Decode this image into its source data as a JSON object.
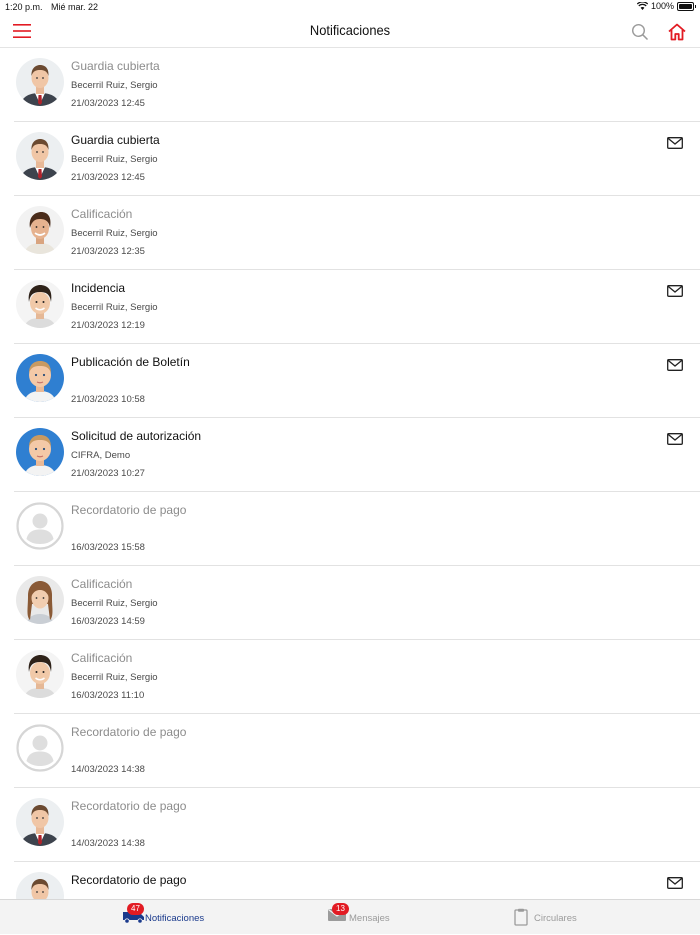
{
  "status_bar": {
    "time": "1:20 p.m.",
    "date": "Mié mar. 22",
    "battery": "100%"
  },
  "header": {
    "title": "Notificaciones"
  },
  "colors": {
    "accent": "#e21b23",
    "active_tab": "#1a3a8c",
    "inactive_tab": "#9b9b9b"
  },
  "notifications": [
    {
      "title": "Guardia cubierta",
      "sender": "Becerril Ruiz, Sergio",
      "date": "21/03/2023 12:45",
      "read": true,
      "has_mail": false,
      "avatar": "man-suit"
    },
    {
      "title": "Guardia cubierta",
      "sender": "Becerril Ruiz, Sergio",
      "date": "21/03/2023 12:45",
      "read": false,
      "has_mail": true,
      "avatar": "man-suit"
    },
    {
      "title": "Calificación",
      "sender": "Becerril Ruiz, Sergio",
      "date": "21/03/2023 12:35",
      "read": true,
      "has_mail": false,
      "avatar": "young-man"
    },
    {
      "title": "Incidencia",
      "sender": "Becerril Ruiz, Sergio",
      "date": "21/03/2023 12:19",
      "read": false,
      "has_mail": true,
      "avatar": "boy-dark-hair"
    },
    {
      "title": "Publicación de Boletín",
      "sender": "",
      "date": "21/03/2023 10:58",
      "read": false,
      "has_mail": true,
      "avatar": "child-blue"
    },
    {
      "title": "Solicitud de autorización",
      "sender": "CIFRA, Demo",
      "date": "21/03/2023 10:27",
      "read": false,
      "has_mail": true,
      "avatar": "child-blue"
    },
    {
      "title": "Recordatorio de pago",
      "sender": "",
      "date": "16/03/2023 15:58",
      "read": true,
      "has_mail": false,
      "avatar": "placeholder"
    },
    {
      "title": "Calificación",
      "sender": "Becerril Ruiz, Sergio",
      "date": "16/03/2023 14:59",
      "read": true,
      "has_mail": false,
      "avatar": "girl"
    },
    {
      "title": "Calificación",
      "sender": "Becerril Ruiz, Sergio",
      "date": "16/03/2023 11:10",
      "read": true,
      "has_mail": false,
      "avatar": "boy-dark-hair"
    },
    {
      "title": "Recordatorio de pago",
      "sender": "",
      "date": "14/03/2023 14:38",
      "read": true,
      "has_mail": false,
      "avatar": "placeholder"
    },
    {
      "title": "Recordatorio de pago",
      "sender": "",
      "date": "14/03/2023 14:38",
      "read": true,
      "has_mail": false,
      "avatar": "man-suit"
    },
    {
      "title": "Recordatorio de pago",
      "sender": "",
      "date": "",
      "read": false,
      "has_mail": true,
      "avatar": "man-suit"
    }
  ],
  "tabs": [
    {
      "label": "Notificaciones",
      "badge": "47",
      "active": true,
      "icon": "notifications-truck-icon"
    },
    {
      "label": "Mensajes",
      "badge": "13",
      "active": false,
      "icon": "envelope-icon"
    },
    {
      "label": "Circulares",
      "badge": "",
      "active": false,
      "icon": "clipboard-icon"
    }
  ]
}
